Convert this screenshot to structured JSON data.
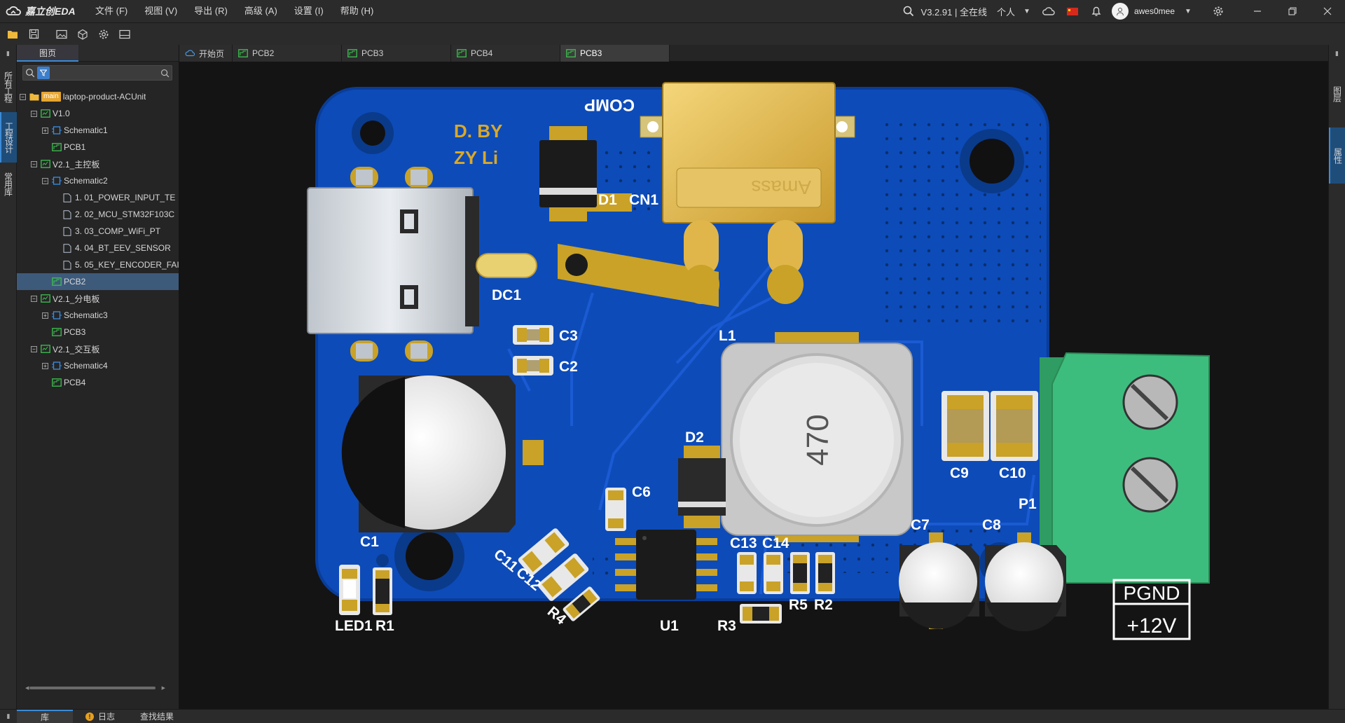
{
  "app": {
    "logo_text": "嘉立创EDA"
  },
  "menu": [
    {
      "label": "文件 (F)"
    },
    {
      "label": "视图 (V)"
    },
    {
      "label": "导出 (R)"
    },
    {
      "label": "高级 (A)"
    },
    {
      "label": "设置 (I)"
    },
    {
      "label": "帮助 (H)"
    }
  ],
  "status": {
    "version": "V3.2.91 | 全在线",
    "workspace": "个人",
    "username": "awes0mee"
  },
  "left_strip": {
    "tabs": [
      "所有工程",
      "工程设计",
      "常用库"
    ],
    "active": "工程设计"
  },
  "panel": {
    "tab": "图页",
    "search_placeholder": ""
  },
  "tree": [
    {
      "level": 0,
      "toggle": "-",
      "icon": "folder",
      "tag": "main",
      "label": "laptop-product-ACUnit"
    },
    {
      "level": 1,
      "toggle": "-",
      "icon": "board",
      "label": "V1.0"
    },
    {
      "level": 2,
      "toggle": "+",
      "icon": "schematic",
      "label": "Schematic1"
    },
    {
      "level": 2,
      "toggle": "",
      "icon": "pcb",
      "label": "PCB1"
    },
    {
      "level": 1,
      "toggle": "-",
      "icon": "board",
      "label": "V2.1_主控板"
    },
    {
      "level": 2,
      "toggle": "-",
      "icon": "schematic",
      "label": "Schematic2"
    },
    {
      "level": 3,
      "toggle": "",
      "icon": "page",
      "label": "1. 01_POWER_INPUT_TE"
    },
    {
      "level": 3,
      "toggle": "",
      "icon": "page",
      "label": "2. 02_MCU_STM32F103C"
    },
    {
      "level": 3,
      "toggle": "",
      "icon": "page",
      "label": "3. 03_COMP_WiFi_PT"
    },
    {
      "level": 3,
      "toggle": "",
      "icon": "page",
      "label": "4. 04_BT_EEV_SENSOR"
    },
    {
      "level": 3,
      "toggle": "",
      "icon": "page",
      "label": "5. 05_KEY_ENCODER_FAI"
    },
    {
      "level": 2,
      "toggle": "",
      "icon": "pcb",
      "label": "PCB2",
      "selected": true
    },
    {
      "level": 1,
      "toggle": "-",
      "icon": "board",
      "label": "V2.1_分电板"
    },
    {
      "level": 2,
      "toggle": "+",
      "icon": "schematic",
      "label": "Schematic3"
    },
    {
      "level": 2,
      "toggle": "",
      "icon": "pcb",
      "label": "PCB3"
    },
    {
      "level": 1,
      "toggle": "-",
      "icon": "board",
      "label": "V2.1_交互板"
    },
    {
      "level": 2,
      "toggle": "+",
      "icon": "schematic",
      "label": "Schematic4"
    },
    {
      "level": 2,
      "toggle": "",
      "icon": "pcb",
      "label": "PCB4"
    }
  ],
  "doc_tabs": [
    {
      "label": "开始页",
      "icon": "home",
      "active": false
    },
    {
      "label": "PCB2",
      "icon": "pcb",
      "active": false
    },
    {
      "label": "PCB3",
      "icon": "pcb",
      "active": false
    },
    {
      "label": "PCB4",
      "icon": "pcb",
      "active": false
    },
    {
      "label": "PCB3",
      "icon": "pcb",
      "active": true
    }
  ],
  "right_strip": {
    "tabs": [
      "图层",
      "属性"
    ]
  },
  "bottom_tabs": [
    {
      "label": "库",
      "active": true
    },
    {
      "label": "日志",
      "warn": true
    },
    {
      "label": "查找结果"
    }
  ],
  "pcb": {
    "silkscreen": {
      "designer": "D. BY",
      "designer2": "ZY Li",
      "comp": "COMP",
      "brand": "Amass",
      "inductor_value": "470",
      "pgnd": "PGND",
      "v12": "+12V"
    },
    "refs": [
      "D1",
      "CN1",
      "DC1",
      "C3",
      "C2",
      "L1",
      "C9",
      "C10",
      "P1",
      "D2",
      "C6",
      "C1",
      "C7",
      "C8",
      "C11",
      "C12",
      "C13",
      "C14",
      "LED1",
      "R1",
      "R4",
      "U1",
      "R3",
      "R5",
      "R2"
    ],
    "colors": {
      "board": "#0d4bb8",
      "silk": "#ffffff",
      "gold": "#c9a227",
      "terminal": "#3dbd7d"
    }
  }
}
